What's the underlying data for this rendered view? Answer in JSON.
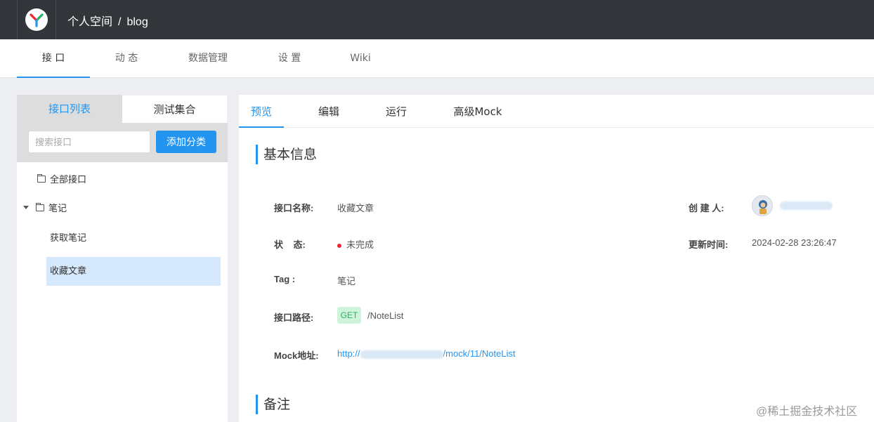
{
  "header": {
    "space": "个人空间",
    "separator": "/",
    "project": "blog"
  },
  "project_tabs": [
    "接 口",
    "动 态",
    "数据管理",
    "设 置",
    "Wiki"
  ],
  "left_panel": {
    "tabs": [
      "接口列表",
      "测试集合"
    ],
    "search_placeholder": "搜索接口",
    "add_button": "添加分类",
    "tree": {
      "all": "全部接口",
      "category": "笔记",
      "items": [
        "获取笔记",
        "收藏文章"
      ]
    }
  },
  "right_panel": {
    "tabs": [
      "预览",
      "编辑",
      "运行",
      "高级Mock"
    ],
    "section_basic": "基本信息",
    "section_notes": "备注",
    "fields": {
      "name_label": "接口名称:",
      "name_value": "收藏文章",
      "status_label": "状    态:",
      "status_value": "未完成",
      "tag_label": "Tag :",
      "tag_value": "笔记",
      "path_label": "接口路径:",
      "method": "GET",
      "path_value": "/NoteList",
      "mock_label": "Mock地址:",
      "mock_prefix": "http://",
      "mock_suffix": "/mock/11/NoteList",
      "creator_label": "创 建 人:",
      "updated_label": "更新时间:",
      "updated_value": "2024-02-28 23:26:47"
    }
  },
  "watermark": "@稀土掘金技术社区",
  "colors": {
    "accent": "#2395f1",
    "topbar": "#32363a",
    "status_dot": "#f5222d",
    "get_bg": "#cff4dc",
    "get_text": "#2bb05e"
  }
}
